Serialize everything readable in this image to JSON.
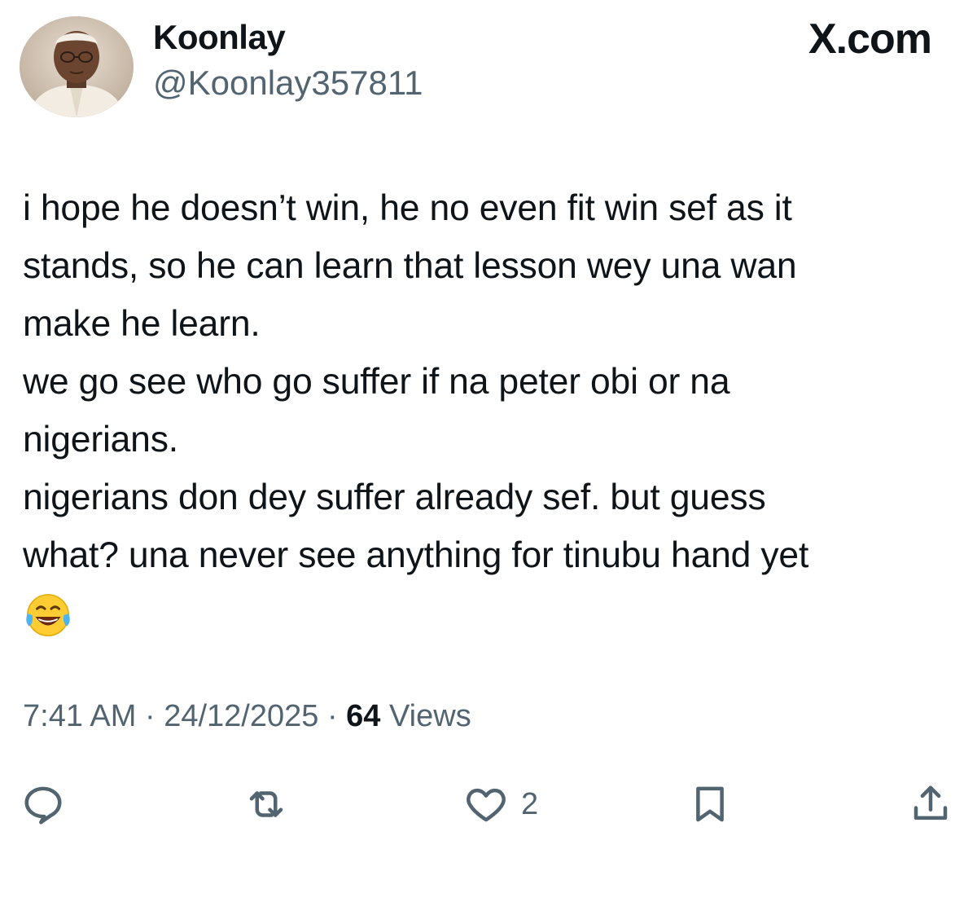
{
  "author": {
    "display_name": "Koonlay",
    "handle": "@Koonlay357811"
  },
  "brand": "X.com",
  "tweet": {
    "lines": [
      "i hope he doesn’t win, he no even fit win sef as it",
      "stands, so he can learn that lesson wey una wan",
      "make he learn.",
      "we go see who go suffer if na peter obi or na",
      "nigerians.",
      "nigerians don dey suffer already sef. but guess",
      "what? una never see anything for tinubu hand yet"
    ],
    "emoji": "face-with-tears-of-joy"
  },
  "meta": {
    "time": "7:41 AM",
    "separator": "·",
    "date": "24/12/2025",
    "views_count": "64",
    "views_label": "Views"
  },
  "actions": {
    "reply_icon": "reply-icon",
    "repost_icon": "repost-icon",
    "like_icon": "heart-icon",
    "like_count": "2",
    "bookmark_icon": "bookmark-icon",
    "share_icon": "share-icon"
  },
  "colors": {
    "text_primary": "#0f1419",
    "text_secondary": "#536471",
    "background": "#ffffff"
  }
}
